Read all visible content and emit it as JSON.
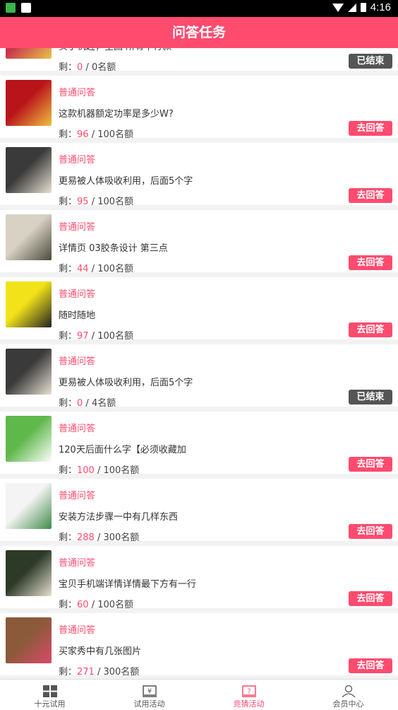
{
  "status": {
    "time": "4:16"
  },
  "header": {
    "title": "问答任务"
  },
  "items": [
    {
      "type": "",
      "title": "买手机赶，全国·所有平行款",
      "remain": "0",
      "total": "0名额",
      "button": "已结束",
      "state": "ended",
      "thumb": [
        "#c8344a",
        "#e8c24a"
      ]
    },
    {
      "type": "普通问答",
      "title": "这款机器额定功率是多少W?",
      "remain": "96",
      "total": "100名额",
      "button": "去回答",
      "state": "active",
      "thumb": [
        "#b8141a",
        "#f0c040"
      ]
    },
    {
      "type": "普通问答",
      "title": "更易被人体吸收利用，后面5个字",
      "remain": "95",
      "total": "100名额",
      "button": "去回答",
      "state": "active",
      "thumb": [
        "#3a3a3a",
        "#e9e2d4"
      ]
    },
    {
      "type": "普通问答",
      "title": "详情页 03胶条设计 第三点",
      "remain": "44",
      "total": "100名额",
      "button": "去回答",
      "state": "active",
      "thumb": [
        "#d8d2c4",
        "#4a4a3a"
      ]
    },
    {
      "type": "普通问答",
      "title": "随时随地",
      "remain": "97",
      "total": "100名额",
      "button": "去回答",
      "state": "active",
      "thumb": [
        "#f2e21a",
        "#222222"
      ]
    },
    {
      "type": "普通问答",
      "title": "更易被人体吸收利用，后面5个字",
      "remain": "0",
      "total": "4名额",
      "button": "已结束",
      "state": "ended",
      "thumb": [
        "#3a3a3a",
        "#e9e2d4"
      ]
    },
    {
      "type": "普通问答",
      "title": "120天后面什么字【必须收藏加",
      "remain": "100",
      "total": "100名额",
      "button": "去回答",
      "state": "active",
      "thumb": [
        "#5fb84a",
        "#ffffff"
      ]
    },
    {
      "type": "普通问答",
      "title": "安装方法步骤一中有几样东西",
      "remain": "288",
      "total": "300名额",
      "button": "去回答",
      "state": "active",
      "thumb": [
        "#f4f4f4",
        "#3f8a4a"
      ]
    },
    {
      "type": "普通问答",
      "title": "宝贝手机端详情详情最下方有一行",
      "remain": "60",
      "total": "100名额",
      "button": "去回答",
      "state": "active",
      "thumb": [
        "#2e3a28",
        "#e6e0d0"
      ]
    },
    {
      "type": "普通问答",
      "title": "买家秀中有几张图片",
      "remain": "271",
      "total": "300名额",
      "button": "去回答",
      "state": "active",
      "thumb": [
        "#8a5a3a",
        "#d94a6a"
      ]
    }
  ],
  "remain_label": "剩：",
  "tabs": [
    {
      "label": "十元试用",
      "icon": "grid-icon",
      "active": false
    },
    {
      "label": "试用活动",
      "icon": "yen-icon",
      "active": false
    },
    {
      "label": "竞猜活动",
      "icon": "question-icon",
      "active": true
    },
    {
      "label": "会员中心",
      "icon": "user-icon",
      "active": false
    }
  ],
  "colors": {
    "accent": "#ff4b6e",
    "ended": "#555555"
  }
}
